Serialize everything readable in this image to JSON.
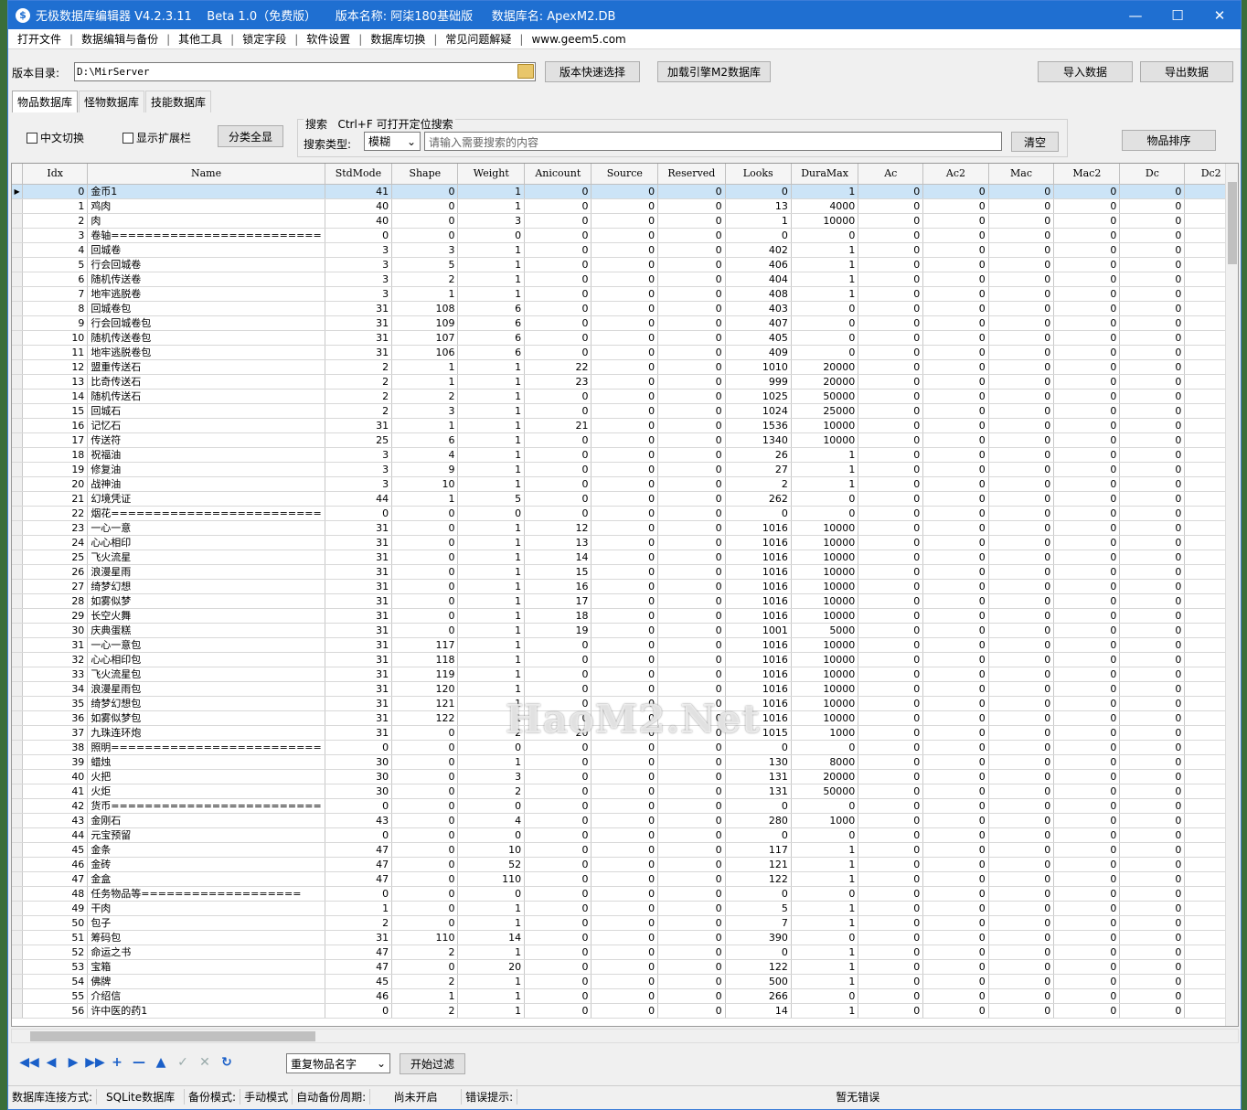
{
  "window": {
    "title": "无极数据库编辑器 V4.2.3.11    Beta 1.0（免费版）     版本名称: 阿柒180基础版     数据库名: ApexM2.DB"
  },
  "menu": [
    "打开文件",
    "数据编辑与备份",
    "其他工具",
    "锁定字段",
    "软件设置",
    "数据库切换",
    "常见问题解疑",
    "www.geem5.com"
  ],
  "path": {
    "label": "版本目录:",
    "value": "D:\\MirServer",
    "quick_select": "版本快速选择",
    "load_engine": "加载引擎M2数据库",
    "import": "导入数据",
    "export": "导出数据"
  },
  "tabs": [
    "物品数据库",
    "怪物数据库",
    "技能数据库"
  ],
  "filters": {
    "chinese_toggle": "中文切换",
    "show_ext": "显示扩展栏",
    "show_all": "分类全显",
    "search_title": "搜索   Ctrl+F 可打开定位搜索",
    "search_type_label": "搜索类型:",
    "search_type_value": "模糊",
    "search_placeholder": "请输入需要搜索的内容",
    "clear": "清空",
    "sort": "物品排序"
  },
  "grid": {
    "columns": [
      "Idx",
      "Name",
      "StdMode",
      "Shape",
      "Weight",
      "Anicount",
      "Source",
      "Reserved",
      "Looks",
      "DuraMax",
      "Ac",
      "Ac2",
      "Mac",
      "Mac2",
      "Dc",
      "Dc2"
    ],
    "rows": [
      [
        0,
        "金币1",
        41,
        0,
        1,
        0,
        0,
        0,
        0,
        1,
        0,
        0,
        0,
        0,
        0
      ],
      [
        1,
        "鸡肉",
        40,
        0,
        1,
        0,
        0,
        0,
        13,
        4000,
        0,
        0,
        0,
        0,
        0
      ],
      [
        2,
        "肉",
        40,
        0,
        3,
        0,
        0,
        0,
        1,
        10000,
        0,
        0,
        0,
        0,
        0
      ],
      [
        3,
        "卷轴=========================",
        0,
        0,
        0,
        0,
        0,
        0,
        0,
        0,
        0,
        0,
        0,
        0,
        0
      ],
      [
        4,
        "回城卷",
        3,
        3,
        1,
        0,
        0,
        0,
        402,
        1,
        0,
        0,
        0,
        0,
        0
      ],
      [
        5,
        "行会回城卷",
        3,
        5,
        1,
        0,
        0,
        0,
        406,
        1,
        0,
        0,
        0,
        0,
        0
      ],
      [
        6,
        "随机传送卷",
        3,
        2,
        1,
        0,
        0,
        0,
        404,
        1,
        0,
        0,
        0,
        0,
        0
      ],
      [
        7,
        "地牢逃脱卷",
        3,
        1,
        1,
        0,
        0,
        0,
        408,
        1,
        0,
        0,
        0,
        0,
        0
      ],
      [
        8,
        "回城卷包",
        31,
        108,
        6,
        0,
        0,
        0,
        403,
        0,
        0,
        0,
        0,
        0,
        0
      ],
      [
        9,
        "行会回城卷包",
        31,
        109,
        6,
        0,
        0,
        0,
        407,
        0,
        0,
        0,
        0,
        0,
        0
      ],
      [
        10,
        "随机传送卷包",
        31,
        107,
        6,
        0,
        0,
        0,
        405,
        0,
        0,
        0,
        0,
        0,
        0
      ],
      [
        11,
        "地牢逃脱卷包",
        31,
        106,
        6,
        0,
        0,
        0,
        409,
        0,
        0,
        0,
        0,
        0,
        0
      ],
      [
        12,
        "盟重传送石",
        2,
        1,
        1,
        22,
        0,
        0,
        1010,
        20000,
        0,
        0,
        0,
        0,
        0
      ],
      [
        13,
        "比奇传送石",
        2,
        1,
        1,
        23,
        0,
        0,
        999,
        20000,
        0,
        0,
        0,
        0,
        0
      ],
      [
        14,
        "随机传送石",
        2,
        2,
        1,
        0,
        0,
        0,
        1025,
        50000,
        0,
        0,
        0,
        0,
        0
      ],
      [
        15,
        "回城石",
        2,
        3,
        1,
        0,
        0,
        0,
        1024,
        25000,
        0,
        0,
        0,
        0,
        0
      ],
      [
        16,
        "记忆石",
        31,
        1,
        1,
        21,
        0,
        0,
        1536,
        10000,
        0,
        0,
        0,
        0,
        0
      ],
      [
        17,
        "传送符",
        25,
        6,
        1,
        0,
        0,
        0,
        1340,
        10000,
        0,
        0,
        0,
        0,
        0
      ],
      [
        18,
        "祝福油",
        3,
        4,
        1,
        0,
        0,
        0,
        26,
        1,
        0,
        0,
        0,
        0,
        0
      ],
      [
        19,
        "修复油",
        3,
        9,
        1,
        0,
        0,
        0,
        27,
        1,
        0,
        0,
        0,
        0,
        0
      ],
      [
        20,
        "战神油",
        3,
        10,
        1,
        0,
        0,
        0,
        2,
        1,
        0,
        0,
        0,
        0,
        0
      ],
      [
        21,
        "幻境凭证",
        44,
        1,
        5,
        0,
        0,
        0,
        262,
        0,
        0,
        0,
        0,
        0,
        0
      ],
      [
        22,
        "烟花=========================",
        0,
        0,
        0,
        0,
        0,
        0,
        0,
        0,
        0,
        0,
        0,
        0,
        0
      ],
      [
        23,
        "一心一意",
        31,
        0,
        1,
        12,
        0,
        0,
        1016,
        10000,
        0,
        0,
        0,
        0,
        0
      ],
      [
        24,
        "心心相印",
        31,
        0,
        1,
        13,
        0,
        0,
        1016,
        10000,
        0,
        0,
        0,
        0,
        0
      ],
      [
        25,
        "飞火流星",
        31,
        0,
        1,
        14,
        0,
        0,
        1016,
        10000,
        0,
        0,
        0,
        0,
        0
      ],
      [
        26,
        "浪漫星雨",
        31,
        0,
        1,
        15,
        0,
        0,
        1016,
        10000,
        0,
        0,
        0,
        0,
        0
      ],
      [
        27,
        "绮梦幻想",
        31,
        0,
        1,
        16,
        0,
        0,
        1016,
        10000,
        0,
        0,
        0,
        0,
        0
      ],
      [
        28,
        "如雾似梦",
        31,
        0,
        1,
        17,
        0,
        0,
        1016,
        10000,
        0,
        0,
        0,
        0,
        0
      ],
      [
        29,
        "长空火舞",
        31,
        0,
        1,
        18,
        0,
        0,
        1016,
        10000,
        0,
        0,
        0,
        0,
        0
      ],
      [
        30,
        "庆典蛋糕",
        31,
        0,
        1,
        19,
        0,
        0,
        1001,
        5000,
        0,
        0,
        0,
        0,
        0
      ],
      [
        31,
        "一心一意包",
        31,
        117,
        1,
        0,
        0,
        0,
        1016,
        10000,
        0,
        0,
        0,
        0,
        0
      ],
      [
        32,
        "心心相印包",
        31,
        118,
        1,
        0,
        0,
        0,
        1016,
        10000,
        0,
        0,
        0,
        0,
        0
      ],
      [
        33,
        "飞火流星包",
        31,
        119,
        1,
        0,
        0,
        0,
        1016,
        10000,
        0,
        0,
        0,
        0,
        0
      ],
      [
        34,
        "浪漫星雨包",
        31,
        120,
        1,
        0,
        0,
        0,
        1016,
        10000,
        0,
        0,
        0,
        0,
        0
      ],
      [
        35,
        "绮梦幻想包",
        31,
        121,
        1,
        0,
        0,
        0,
        1016,
        10000,
        0,
        0,
        0,
        0,
        0
      ],
      [
        36,
        "如雾似梦包",
        31,
        122,
        1,
        0,
        0,
        0,
        1016,
        10000,
        0,
        0,
        0,
        0,
        0
      ],
      [
        37,
        "九珠连环炮",
        31,
        0,
        2,
        20,
        0,
        0,
        1015,
        1000,
        0,
        0,
        0,
        0,
        0
      ],
      [
        38,
        "照明=========================",
        0,
        0,
        0,
        0,
        0,
        0,
        0,
        0,
        0,
        0,
        0,
        0,
        0
      ],
      [
        39,
        "蜡烛",
        30,
        0,
        1,
        0,
        0,
        0,
        130,
        8000,
        0,
        0,
        0,
        0,
        0
      ],
      [
        40,
        "火把",
        30,
        0,
        3,
        0,
        0,
        0,
        131,
        20000,
        0,
        0,
        0,
        0,
        0
      ],
      [
        41,
        "火炬",
        30,
        0,
        2,
        0,
        0,
        0,
        131,
        50000,
        0,
        0,
        0,
        0,
        0
      ],
      [
        42,
        "货币=========================",
        0,
        0,
        0,
        0,
        0,
        0,
        0,
        0,
        0,
        0,
        0,
        0,
        0
      ],
      [
        43,
        "金刚石",
        43,
        0,
        4,
        0,
        0,
        0,
        280,
        1000,
        0,
        0,
        0,
        0,
        0
      ],
      [
        44,
        "元宝预留",
        0,
        0,
        0,
        0,
        0,
        0,
        0,
        0,
        0,
        0,
        0,
        0,
        0
      ],
      [
        45,
        "金条",
        47,
        0,
        10,
        0,
        0,
        0,
        117,
        1,
        0,
        0,
        0,
        0,
        0
      ],
      [
        46,
        "金砖",
        47,
        0,
        52,
        0,
        0,
        0,
        121,
        1,
        0,
        0,
        0,
        0,
        0
      ],
      [
        47,
        "金盒",
        47,
        0,
        110,
        0,
        0,
        0,
        122,
        1,
        0,
        0,
        0,
        0,
        0
      ],
      [
        48,
        "任务物品等===================",
        0,
        0,
        0,
        0,
        0,
        0,
        0,
        0,
        0,
        0,
        0,
        0,
        0
      ],
      [
        49,
        "干肉",
        1,
        0,
        1,
        0,
        0,
        0,
        5,
        1,
        0,
        0,
        0,
        0,
        0
      ],
      [
        50,
        "包子",
        2,
        0,
        1,
        0,
        0,
        0,
        7,
        1,
        0,
        0,
        0,
        0,
        0
      ],
      [
        51,
        "筹码包",
        31,
        110,
        14,
        0,
        0,
        0,
        390,
        0,
        0,
        0,
        0,
        0,
        0
      ],
      [
        52,
        "命运之书",
        47,
        2,
        1,
        0,
        0,
        0,
        0,
        1,
        0,
        0,
        0,
        0,
        0
      ],
      [
        53,
        "宝箱",
        47,
        0,
        20,
        0,
        0,
        0,
        122,
        1,
        0,
        0,
        0,
        0,
        0
      ],
      [
        54,
        "佛牌",
        45,
        2,
        1,
        0,
        0,
        0,
        500,
        1,
        0,
        0,
        0,
        0,
        0
      ],
      [
        55,
        "介绍信",
        46,
        1,
        1,
        0,
        0,
        0,
        266,
        0,
        0,
        0,
        0,
        0,
        0
      ],
      [
        56,
        "许中医的药1",
        0,
        2,
        1,
        0,
        0,
        0,
        14,
        1,
        0,
        0,
        0,
        0,
        0
      ]
    ]
  },
  "bottom": {
    "dup_select": "重复物品名字",
    "start_filter": "开始过滤"
  },
  "status": {
    "conn_label": "数据库连接方式:",
    "conn_value": "SQLite数据库",
    "backup_label": "备份模式:",
    "backup_value": "手动模式",
    "auto_label": "自动备份周期:",
    "auto_value": "尚未开启",
    "error_label": "错误提示:",
    "error_value": "暂无错误"
  },
  "watermark": "HaoM2.Net"
}
